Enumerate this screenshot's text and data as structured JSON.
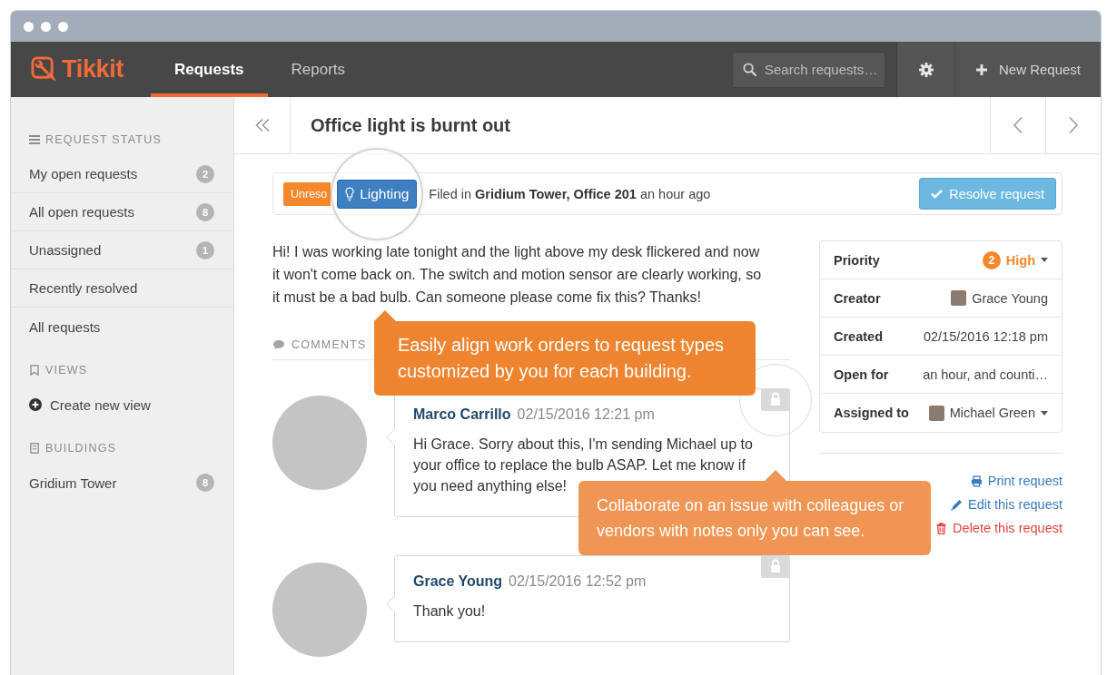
{
  "navbar": {
    "logo": "Tikkit",
    "tabs": [
      {
        "label": "Requests",
        "selected": true
      },
      {
        "label": "Reports",
        "selected": false
      }
    ],
    "search": {
      "placeholder": "Search requests…"
    },
    "new_button": "New Request"
  },
  "sidebar": {
    "sections": [
      {
        "kind": "status",
        "title": "REQUEST STATUS",
        "items": [
          {
            "kind": "filter",
            "label": "My open requests",
            "count": "2",
            "selected": false
          },
          {
            "kind": "filter",
            "label": "All open requests",
            "count": "8",
            "selected": false
          },
          {
            "kind": "filter",
            "label": "Unassigned",
            "count": "1",
            "selected": false
          },
          {
            "kind": "filter",
            "label": "Recently resolved",
            "selected": false
          },
          {
            "kind": "filter",
            "label": "All requests",
            "selected": false
          }
        ]
      },
      {
        "kind": "views",
        "title": "VIEWS",
        "items": [
          {
            "kind": "create",
            "label": "Create new view",
            "selected": false
          }
        ]
      },
      {
        "kind": "buildings",
        "title": "BUILDINGS",
        "items": [
          {
            "kind": "filter",
            "label": "Gridium Tower",
            "count": "8",
            "selected": false
          }
        ]
      }
    ]
  },
  "request": {
    "title": "Office light is burnt out",
    "status": "Unreso",
    "category": "Lighting",
    "filed": "Filed in **Gridium Tower, Office 201** an hour ago",
    "resolve_button": "Resolve request",
    "description": "Hi! I was working late tonight and the light above my desk flickered and now it won't come back on. The switch and motion sensor are clearly working, so it must be a bad bulb. Can someone please come fix this? Thanks!"
  },
  "details": [
    {
      "kind": "priority",
      "label": "Priority",
      "badge": "2",
      "value": "High",
      "dropdown": true
    },
    {
      "kind": "person",
      "label": "Creator",
      "value": "Grace Young",
      "dropdown": false
    },
    {
      "kind": "text",
      "label": "Created",
      "value": "02/15/2016 12:18 pm",
      "dropdown": false
    },
    {
      "kind": "text",
      "label": "Open for",
      "value": "an hour, and counti…",
      "dropdown": false
    },
    {
      "kind": "person",
      "label": "Assigned to",
      "value": "Michael Green",
      "dropdown": true
    }
  ],
  "actions": [
    {
      "kind": "print",
      "label": "Print request"
    },
    {
      "kind": "edit",
      "label": "Edit this request"
    },
    {
      "kind": "delete",
      "label": "Delete this request"
    }
  ],
  "comments": {
    "heading": "COMMENTS",
    "items": [
      {
        "author": "Marco Carrillo",
        "time": "02/15/2016 12:21 pm",
        "text": "Hi Grace. Sorry about this, I'm sending Michael up to your office to replace the bulb ASAP. Let me know if you need anything else!",
        "private": true
      },
      {
        "author": "Grace Young",
        "time": "02/15/2016 12:52 pm",
        "text": "Thank you!",
        "private": true
      }
    ]
  },
  "callouts": [
    {
      "text": "Easily align work orders to request types customized by you for each building.",
      "faded": false
    },
    {
      "text": "Collaborate on an issue with colleagues or vendors with notes only you can see.",
      "faded": true
    }
  ]
}
